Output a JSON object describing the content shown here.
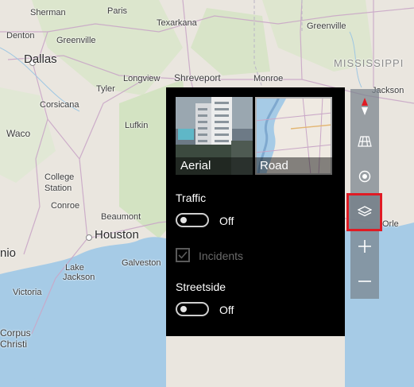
{
  "map": {
    "cities": {
      "sherman": "Sherman",
      "paris": "Paris",
      "texarkana": "Texarkana",
      "denton": "Denton",
      "greenville": "Greenville",
      "greenville_ms": "Greenville",
      "dallas": "Dallas",
      "mississippi": "MISSISSIPPI",
      "tyler": "Tyler",
      "longview": "Longview",
      "shreveport": "Shreveport",
      "monroe": "Monroe",
      "jackson": "Jackson",
      "corsicana": "Corsicana",
      "waco": "Waco",
      "lufkin": "Lufkin",
      "college": "College",
      "station": "Station",
      "conroe": "Conroe",
      "beaumont": "Beaumont",
      "houston": "Houston",
      "orleans": "Orle",
      "galveston": "Galveston",
      "lake": "Lake",
      "jackson_tx": "Jackson",
      "victoria": "Victoria",
      "corpus": "Corpus",
      "christi": "Christi",
      "nio": "nio"
    }
  },
  "layers_panel": {
    "aerial_label": "Aerial",
    "road_label": "Road",
    "traffic_label": "Traffic",
    "traffic_state": "Off",
    "incidents_label": "Incidents",
    "streetside_label": "Streetside",
    "streetside_state": "Off"
  },
  "toolbar": {
    "compass_icon": "compass-icon",
    "grid_icon": "3d-grid-icon",
    "location_icon": "location-icon",
    "layers_icon": "layers-icon",
    "zoom_in_icon": "plus-icon",
    "zoom_out_icon": "minus-icon"
  },
  "colors": {
    "land": "#eae6df",
    "water": "#a6cbe6",
    "forest": "#d3e3c2",
    "panel_bg": "#000000",
    "highlight": "#e01b24"
  }
}
